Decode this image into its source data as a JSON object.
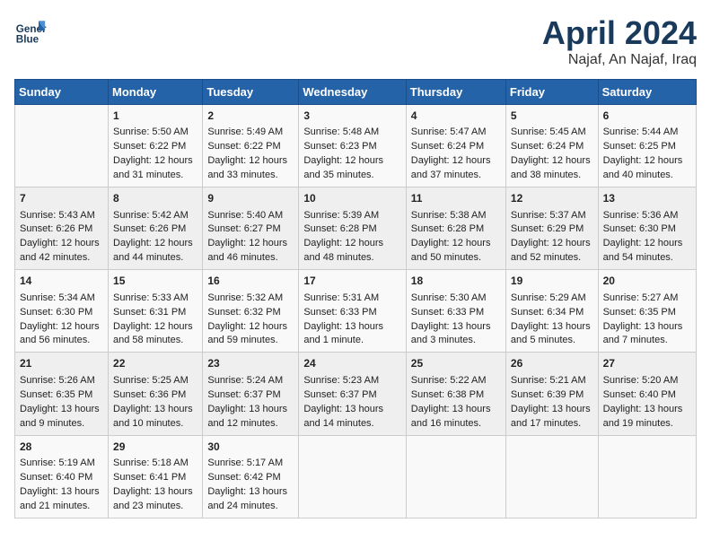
{
  "header": {
    "logo_line1": "General",
    "logo_line2": "Blue",
    "month": "April 2024",
    "location": "Najaf, An Najaf, Iraq"
  },
  "weekdays": [
    "Sunday",
    "Monday",
    "Tuesday",
    "Wednesday",
    "Thursday",
    "Friday",
    "Saturday"
  ],
  "weeks": [
    [
      {
        "day": "",
        "empty": true
      },
      {
        "day": "1",
        "sunrise": "5:50 AM",
        "sunset": "6:22 PM",
        "daylight": "12 hours and 31 minutes."
      },
      {
        "day": "2",
        "sunrise": "5:49 AM",
        "sunset": "6:22 PM",
        "daylight": "12 hours and 33 minutes."
      },
      {
        "day": "3",
        "sunrise": "5:48 AM",
        "sunset": "6:23 PM",
        "daylight": "12 hours and 35 minutes."
      },
      {
        "day": "4",
        "sunrise": "5:47 AM",
        "sunset": "6:24 PM",
        "daylight": "12 hours and 37 minutes."
      },
      {
        "day": "5",
        "sunrise": "5:45 AM",
        "sunset": "6:24 PM",
        "daylight": "12 hours and 38 minutes."
      },
      {
        "day": "6",
        "sunrise": "5:44 AM",
        "sunset": "6:25 PM",
        "daylight": "12 hours and 40 minutes."
      }
    ],
    [
      {
        "day": "7",
        "sunrise": "5:43 AM",
        "sunset": "6:26 PM",
        "daylight": "12 hours and 42 minutes."
      },
      {
        "day": "8",
        "sunrise": "5:42 AM",
        "sunset": "6:26 PM",
        "daylight": "12 hours and 44 minutes."
      },
      {
        "day": "9",
        "sunrise": "5:40 AM",
        "sunset": "6:27 PM",
        "daylight": "12 hours and 46 minutes."
      },
      {
        "day": "10",
        "sunrise": "5:39 AM",
        "sunset": "6:28 PM",
        "daylight": "12 hours and 48 minutes."
      },
      {
        "day": "11",
        "sunrise": "5:38 AM",
        "sunset": "6:28 PM",
        "daylight": "12 hours and 50 minutes."
      },
      {
        "day": "12",
        "sunrise": "5:37 AM",
        "sunset": "6:29 PM",
        "daylight": "12 hours and 52 minutes."
      },
      {
        "day": "13",
        "sunrise": "5:36 AM",
        "sunset": "6:30 PM",
        "daylight": "12 hours and 54 minutes."
      }
    ],
    [
      {
        "day": "14",
        "sunrise": "5:34 AM",
        "sunset": "6:30 PM",
        "daylight": "12 hours and 56 minutes."
      },
      {
        "day": "15",
        "sunrise": "5:33 AM",
        "sunset": "6:31 PM",
        "daylight": "12 hours and 58 minutes."
      },
      {
        "day": "16",
        "sunrise": "5:32 AM",
        "sunset": "6:32 PM",
        "daylight": "12 hours and 59 minutes."
      },
      {
        "day": "17",
        "sunrise": "5:31 AM",
        "sunset": "6:33 PM",
        "daylight": "13 hours and 1 minute."
      },
      {
        "day": "18",
        "sunrise": "5:30 AM",
        "sunset": "6:33 PM",
        "daylight": "13 hours and 3 minutes."
      },
      {
        "day": "19",
        "sunrise": "5:29 AM",
        "sunset": "6:34 PM",
        "daylight": "13 hours and 5 minutes."
      },
      {
        "day": "20",
        "sunrise": "5:27 AM",
        "sunset": "6:35 PM",
        "daylight": "13 hours and 7 minutes."
      }
    ],
    [
      {
        "day": "21",
        "sunrise": "5:26 AM",
        "sunset": "6:35 PM",
        "daylight": "13 hours and 9 minutes."
      },
      {
        "day": "22",
        "sunrise": "5:25 AM",
        "sunset": "6:36 PM",
        "daylight": "13 hours and 10 minutes."
      },
      {
        "day": "23",
        "sunrise": "5:24 AM",
        "sunset": "6:37 PM",
        "daylight": "13 hours and 12 minutes."
      },
      {
        "day": "24",
        "sunrise": "5:23 AM",
        "sunset": "6:37 PM",
        "daylight": "13 hours and 14 minutes."
      },
      {
        "day": "25",
        "sunrise": "5:22 AM",
        "sunset": "6:38 PM",
        "daylight": "13 hours and 16 minutes."
      },
      {
        "day": "26",
        "sunrise": "5:21 AM",
        "sunset": "6:39 PM",
        "daylight": "13 hours and 17 minutes."
      },
      {
        "day": "27",
        "sunrise": "5:20 AM",
        "sunset": "6:40 PM",
        "daylight": "13 hours and 19 minutes."
      }
    ],
    [
      {
        "day": "28",
        "sunrise": "5:19 AM",
        "sunset": "6:40 PM",
        "daylight": "13 hours and 21 minutes."
      },
      {
        "day": "29",
        "sunrise": "5:18 AM",
        "sunset": "6:41 PM",
        "daylight": "13 hours and 23 minutes."
      },
      {
        "day": "30",
        "sunrise": "5:17 AM",
        "sunset": "6:42 PM",
        "daylight": "13 hours and 24 minutes."
      },
      {
        "day": "",
        "empty": true
      },
      {
        "day": "",
        "empty": true
      },
      {
        "day": "",
        "empty": true
      },
      {
        "day": "",
        "empty": true
      }
    ]
  ]
}
